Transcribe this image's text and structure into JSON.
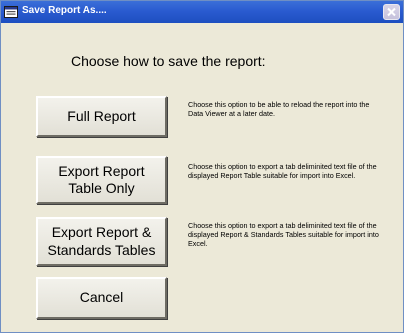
{
  "window": {
    "title": "Save Report As....",
    "close_label": "×"
  },
  "dialog": {
    "heading": "Choose how to save the report:"
  },
  "options": [
    {
      "button_label": "Full Report",
      "description": "Choose this option to be able to reload the report into the Data Viewer at a later date."
    },
    {
      "button_label": "Export Report Table Only",
      "description": "Choose this option to export a tab deliminited text file of the displayed Report Table suitable for import into Excel."
    },
    {
      "button_label": "Export Report & Standards Tables",
      "description": "Choose this option to export a tab deliminited text file of the displayed Report & Standards Tables suitable for import into Excel."
    }
  ],
  "cancel_label": "Cancel",
  "colors": {
    "titlebar": "#2a5bd0",
    "window_background": "#ece9d8",
    "close_button": "#c6c2dc"
  },
  "icons": {
    "window": "app-window-icon",
    "close": "close-icon"
  }
}
